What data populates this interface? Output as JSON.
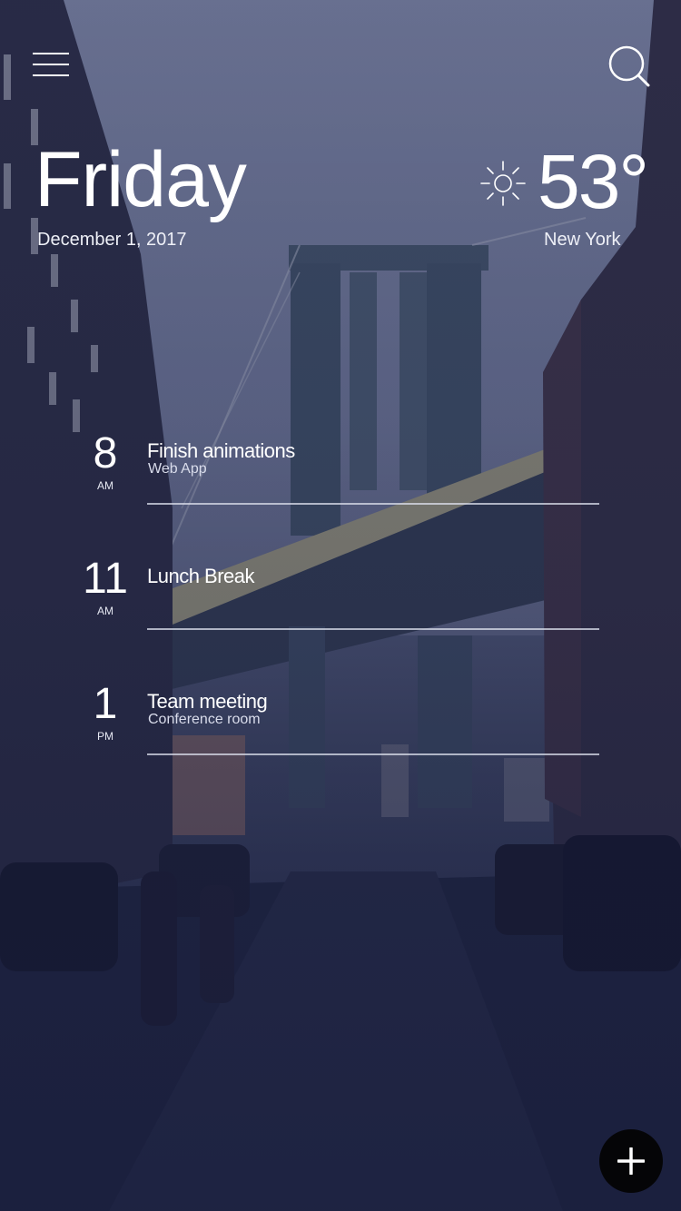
{
  "header": {
    "menu_icon": "hamburger-menu-icon",
    "search_icon": "search-icon"
  },
  "today": {
    "day": "Friday",
    "date": "December 1, 2017"
  },
  "weather": {
    "icon": "sun-icon",
    "temperature": "53°",
    "city": "New York"
  },
  "schedule": [
    {
      "hour": "8",
      "period": "AM",
      "title": "Finish animations",
      "subtitle": "Web App"
    },
    {
      "hour": "11",
      "period": "AM",
      "title": "Lunch Break",
      "subtitle": ""
    },
    {
      "hour": "1",
      "period": "PM",
      "title": "Team meeting",
      "subtitle": "Conference room"
    }
  ],
  "fab": {
    "icon": "plus-icon"
  },
  "colors": {
    "overlay": "#2a3150",
    "text": "#ffffff",
    "fab": "#050507"
  }
}
